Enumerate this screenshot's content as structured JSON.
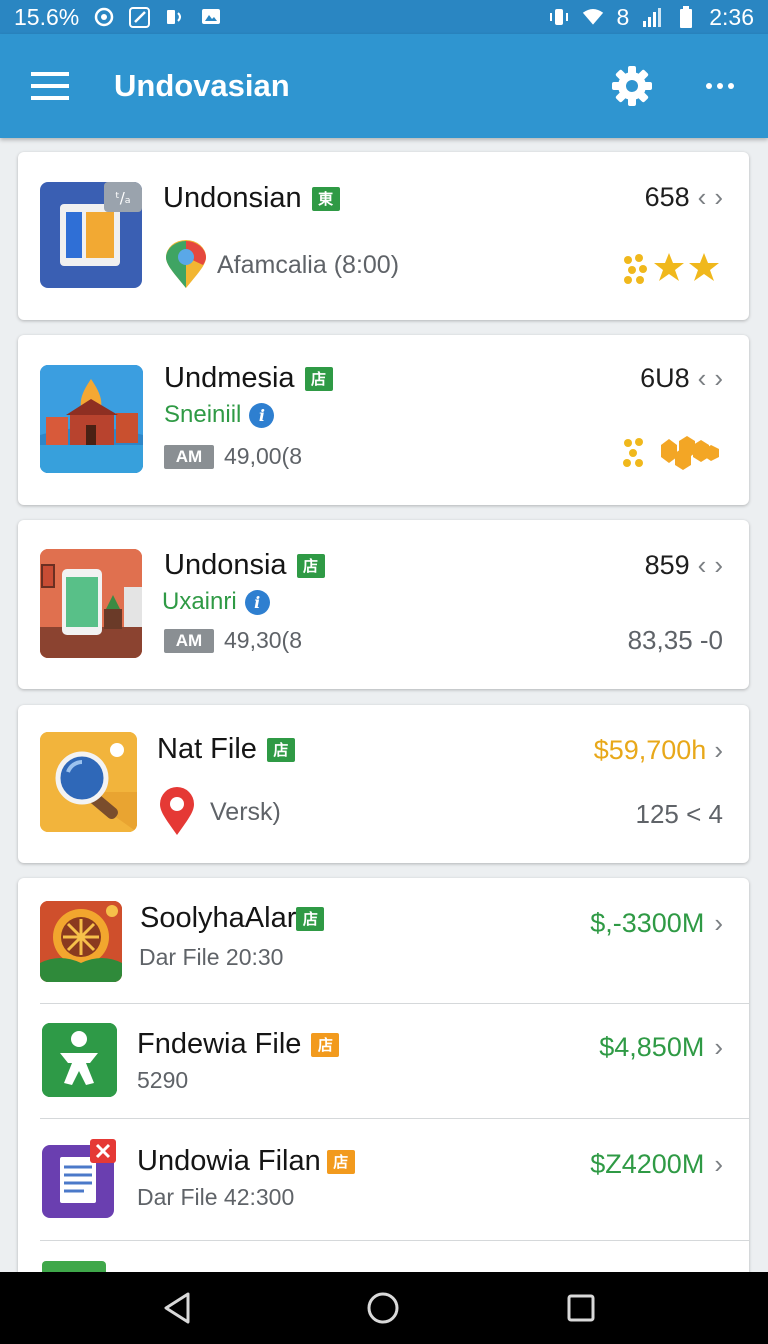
{
  "status_bar": {
    "battery_percent": "15.6%",
    "signal": "8",
    "time": "2:36"
  },
  "app_bar": {
    "title": "Undovasian"
  },
  "cards": [
    {
      "title": "Undonsian",
      "badge": "東",
      "subtitle": "Afamcalia (8:00)",
      "count": "658",
      "rating_icons": "stars"
    },
    {
      "title": "Undmesia",
      "badge": "店",
      "subtitle": "Sneiniil",
      "tag": "AM",
      "meta": "49,00(8",
      "count": "6U8",
      "rating_icons": "honeycomb"
    },
    {
      "title": "Undonsia",
      "badge": "店",
      "subtitle": "Uxainri",
      "tag": "AM",
      "meta": "49,30(8",
      "count": "859",
      "right_meta": "83,35 -0"
    },
    {
      "title": "Nat File",
      "badge": "店",
      "subtitle": "Versk)",
      "price": "$59,700h",
      "right_meta": "125 < 4"
    }
  ],
  "file_list": [
    {
      "title": "SoolyhaAlar",
      "badge": "店",
      "subtitle": "Dar File 20:30",
      "price": "$,-3300M"
    },
    {
      "title": "Fndewia File",
      "badge": "店",
      "subtitle": "5290",
      "price": "$4,850M"
    },
    {
      "title": "Undowia Filan",
      "badge": "店",
      "subtitle": "Dar File 42:300",
      "price": "$Z4200M"
    }
  ],
  "colors": {
    "status_bar": "#2a86c2",
    "app_bar": "#2f95d0",
    "accent_green": "#2f9a45",
    "price_gold": "#e8a81a",
    "info_blue": "#2e7fd0"
  }
}
